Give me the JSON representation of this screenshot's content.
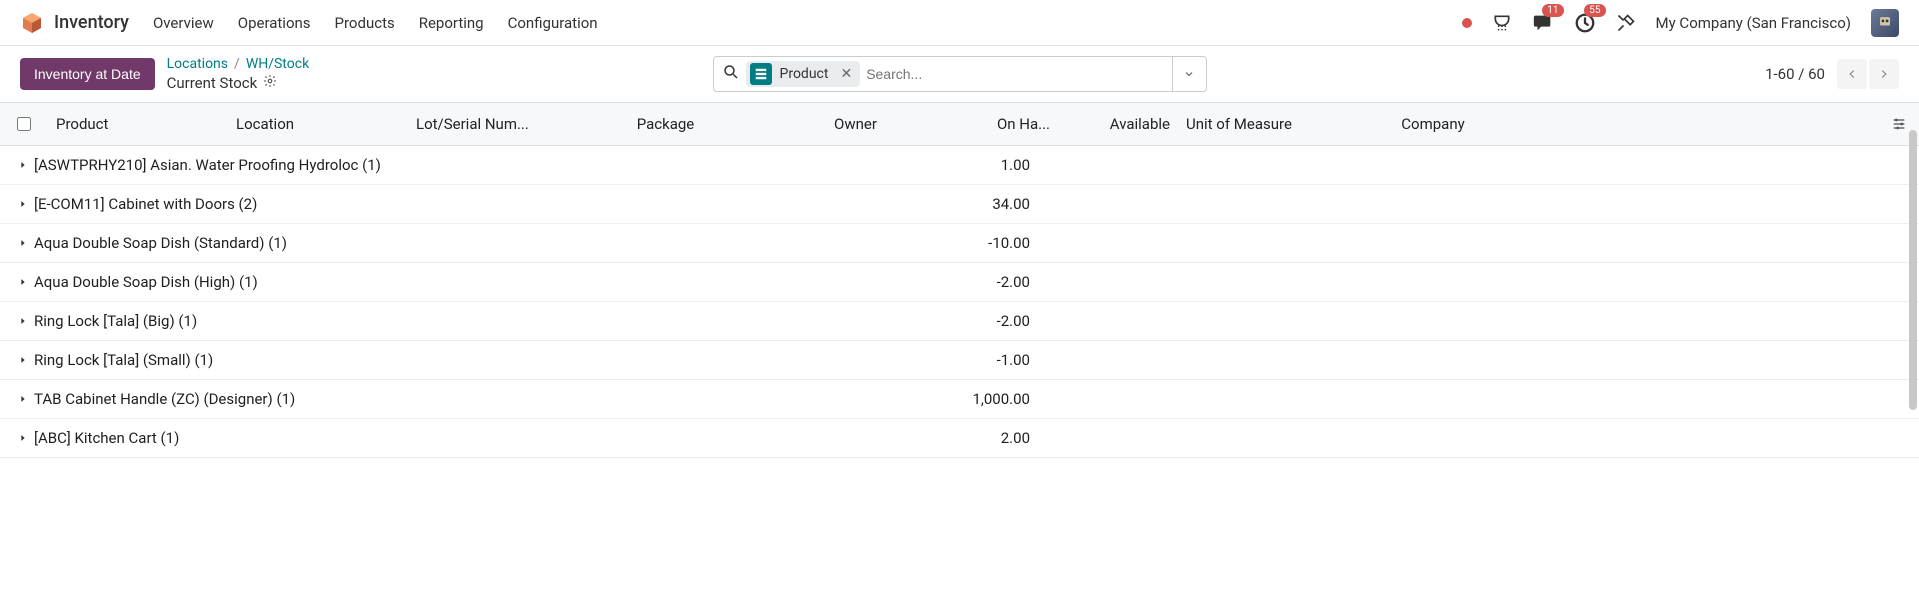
{
  "app": {
    "title": "Inventory"
  },
  "nav": {
    "items": [
      "Overview",
      "Operations",
      "Products",
      "Reporting",
      "Configuration"
    ]
  },
  "header": {
    "company": "My Company (San Francisco)",
    "chat_badge": "11",
    "clock_badge": "55"
  },
  "actionbar": {
    "button": "Inventory at Date",
    "breadcrumb": {
      "link": "Locations",
      "current": "WH/Stock"
    },
    "subtitle": "Current Stock"
  },
  "search": {
    "facet_label": "Product",
    "placeholder": "Search..."
  },
  "pager": {
    "text": "1-60 / 60"
  },
  "columns": {
    "product": "Product",
    "location": "Location",
    "lot": "Lot/Serial Num...",
    "package": "Package",
    "owner": "Owner",
    "onhand": "On Ha...",
    "available": "Available",
    "uom": "Unit of Measure",
    "company": "Company"
  },
  "rows": [
    {
      "product": "[ASWTPRHY210] Asian. Water Proofing Hydroloc (1)",
      "onhand": "1.00"
    },
    {
      "product": "[E-COM11] Cabinet with Doors (2)",
      "onhand": "34.00"
    },
    {
      "product": "Aqua Double Soap Dish (Standard) (1)",
      "onhand": "-10.00"
    },
    {
      "product": "Aqua Double Soap Dish (High) (1)",
      "onhand": "-2.00"
    },
    {
      "product": "Ring Lock [Tala] (Big) (1)",
      "onhand": "-2.00"
    },
    {
      "product": "Ring Lock [Tala] (Small) (1)",
      "onhand": "-1.00"
    },
    {
      "product": "TAB Cabinet Handle (ZC) (Designer) (1)",
      "onhand": "1,000.00"
    },
    {
      "product": "[ABC] Kitchen Cart (1)",
      "onhand": "2.00"
    }
  ]
}
